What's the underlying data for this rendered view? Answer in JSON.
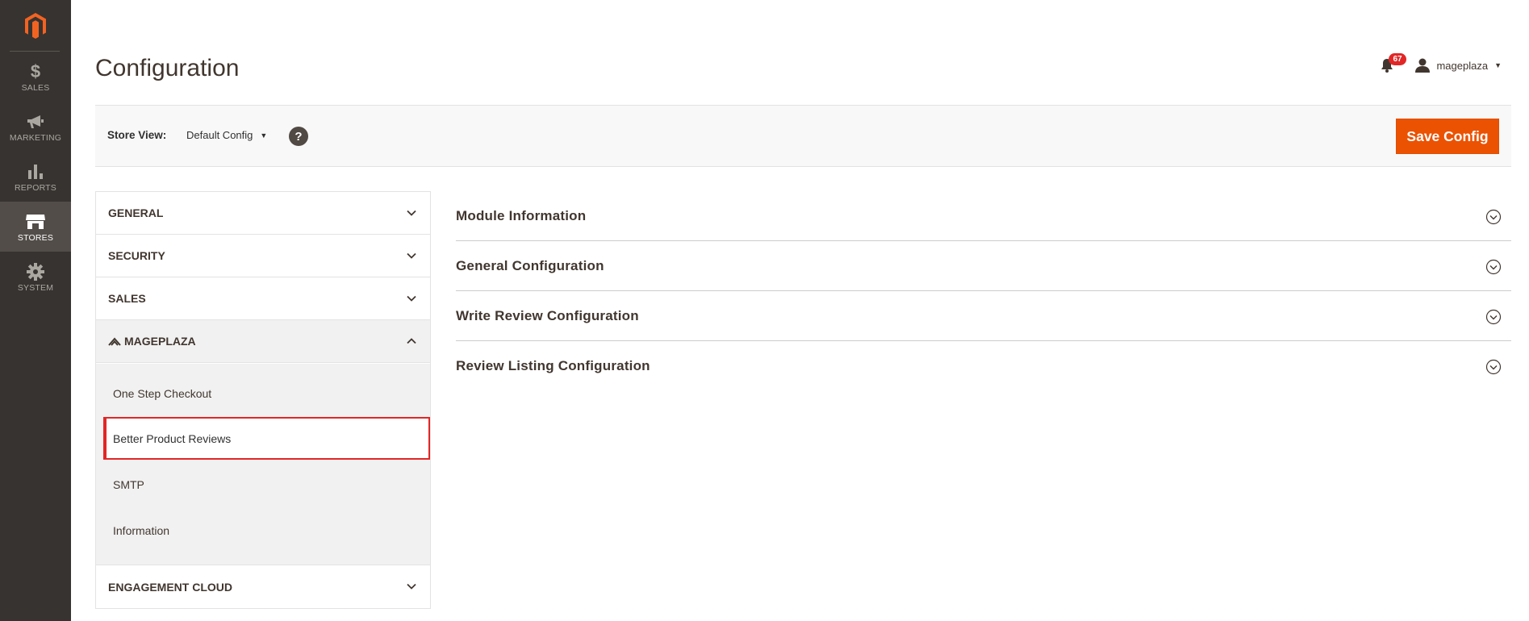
{
  "nav": {
    "items": [
      {
        "label": "SALES",
        "icon": "dollar-icon"
      },
      {
        "label": "MARKETING",
        "icon": "megaphone-icon"
      },
      {
        "label": "REPORTS",
        "icon": "bar-chart-icon"
      },
      {
        "label": "STORES",
        "icon": "storefront-icon",
        "active": true
      },
      {
        "label": "SYSTEM",
        "icon": "gear-icon"
      }
    ]
  },
  "header": {
    "title": "Configuration",
    "notifications_count": "67",
    "user_name": "mageplaza"
  },
  "toolbar": {
    "store_view_label": "Store View:",
    "store_view_value": "Default Config",
    "help_label": "?",
    "save_label": "Save Config"
  },
  "sidebar": {
    "tabs": [
      "GENERAL",
      "SECURITY",
      "SALES",
      "MAGEPLAZA",
      "ENGAGEMENT CLOUD"
    ],
    "mageplaza_items": [
      "One Step Checkout",
      "Better Product Reviews",
      "SMTP",
      "Information"
    ],
    "active_item": "Better Product Reviews"
  },
  "sections": [
    "Module Information",
    "General Configuration",
    "Write Review Configuration",
    "Review Listing Configuration"
  ],
  "colors": {
    "nav_bg": "#373330",
    "accent": "#eb5202",
    "highlight": "#e22626"
  }
}
